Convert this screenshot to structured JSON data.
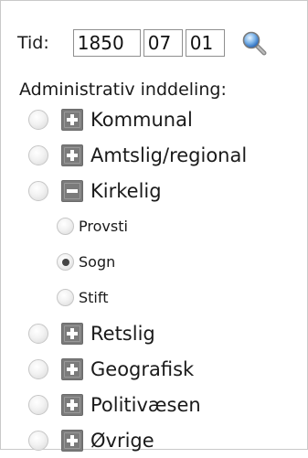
{
  "time": {
    "label": "Tid:",
    "year": "1850",
    "month": "07",
    "day": "01",
    "search_icon": "magnifier-icon"
  },
  "admin": {
    "heading": "Administrativ inddeling:",
    "items": [
      {
        "label": "Kommunal",
        "expanded": false,
        "selected": false
      },
      {
        "label": "Amtslig/regional",
        "expanded": false,
        "selected": false
      },
      {
        "label": "Kirkelig",
        "expanded": true,
        "selected": false,
        "children": [
          {
            "label": "Provsti",
            "selected": false
          },
          {
            "label": "Sogn",
            "selected": true
          },
          {
            "label": "Stift",
            "selected": false
          }
        ]
      },
      {
        "label": "Retslig",
        "expanded": false,
        "selected": false
      },
      {
        "label": "Geografisk",
        "expanded": false,
        "selected": false
      },
      {
        "label": "Politivæsen",
        "expanded": false,
        "selected": false
      },
      {
        "label": "Øvrige",
        "expanded": false,
        "selected": false
      }
    ]
  },
  "colors": {
    "toggle": "#7b7b7b",
    "border": "#8f8f8f",
    "search_lens": "#3a78c8"
  }
}
